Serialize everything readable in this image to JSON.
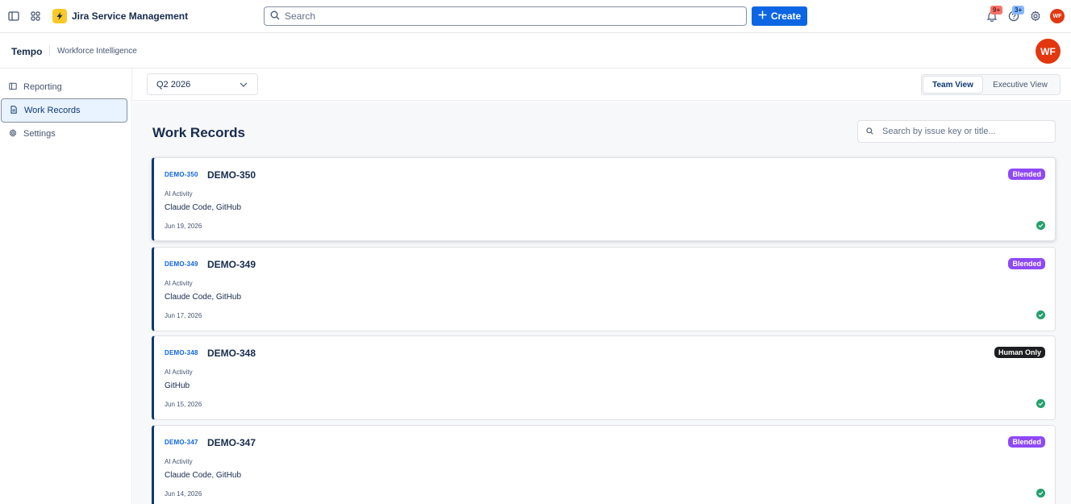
{
  "topbar": {
    "app_name": "Jira Service Management",
    "search_placeholder": "Search",
    "create_label": "Create",
    "notifications_badge": "9+",
    "help_badge": "3+",
    "user_initials": "WF"
  },
  "app_header": {
    "brand": "Tempo",
    "subtitle": "Workforce Intelligence",
    "user_initials": "WF"
  },
  "sidebar": {
    "items": [
      {
        "label": "Reporting",
        "icon": "reporting-icon",
        "active": false
      },
      {
        "label": "Work Records",
        "icon": "document-icon",
        "active": true
      },
      {
        "label": "Settings",
        "icon": "gear-icon",
        "active": false
      }
    ]
  },
  "filters": {
    "quarter": "Q2 2026",
    "views": [
      "Team View",
      "Executive View"
    ],
    "active_view": "Team View"
  },
  "main": {
    "title": "Work Records",
    "search_placeholder": "Search by issue key or title..."
  },
  "records": [
    {
      "key": "DEMO-350",
      "title": "DEMO-350",
      "label": "AI Activity",
      "tools": "Claude Code, GitHub",
      "date": "Jun 19, 2026",
      "tag": "Blended"
    },
    {
      "key": "DEMO-349",
      "title": "DEMO-349",
      "label": "AI Activity",
      "tools": "Claude Code, GitHub",
      "date": "Jun 17, 2026",
      "tag": "Blended"
    },
    {
      "key": "DEMO-348",
      "title": "DEMO-348",
      "label": "AI Activity",
      "tools": "GitHub",
      "date": "Jun 15, 2026",
      "tag": "Human Only"
    },
    {
      "key": "DEMO-347",
      "title": "DEMO-347",
      "label": "AI Activity",
      "tools": "Claude Code, GitHub",
      "date": "Jun 14, 2026",
      "tag": "Blended"
    }
  ],
  "colors": {
    "primary": "#0c66e4",
    "blended": "#8f48f7",
    "human_only": "#1d1e21",
    "success": "#22a06b",
    "avatar": "#e2370f"
  }
}
